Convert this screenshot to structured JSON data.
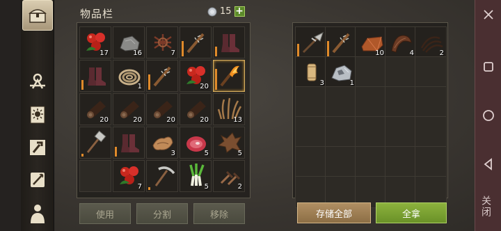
{
  "inventory": {
    "title": "物品栏",
    "currency_count": "15",
    "add_symbol": "+",
    "items": [
      {
        "icon": "berries-icon",
        "qty": "17"
      },
      {
        "icon": "stone-icon",
        "qty": "16"
      },
      {
        "icon": "fiber-bundle-icon",
        "qty": "7"
      },
      {
        "icon": "spiked-club-icon",
        "qty": ""
      },
      {
        "icon": "leather-boots-icon",
        "qty": ""
      },
      {
        "icon": "leather-boots-icon",
        "qty": ""
      },
      {
        "icon": "rope-icon",
        "qty": "1"
      },
      {
        "icon": "spiked-club-icon",
        "qty": ""
      },
      {
        "icon": "berries-icon",
        "qty": "20"
      },
      {
        "icon": "burning-torch-icon",
        "qty": ""
      },
      {
        "icon": "log-icon",
        "qty": "20"
      },
      {
        "icon": "log-icon",
        "qty": "20"
      },
      {
        "icon": "log-icon",
        "qty": "20"
      },
      {
        "icon": "log-icon",
        "qty": "20"
      },
      {
        "icon": "dry-grass-icon",
        "qty": "13"
      },
      {
        "icon": "hammer-icon",
        "qty": ""
      },
      {
        "icon": "leather-boots-icon",
        "qty": ""
      },
      {
        "icon": "leather-scraps-icon",
        "qty": "3"
      },
      {
        "icon": "raw-meat-icon",
        "qty": "5"
      },
      {
        "icon": "animal-hide-icon",
        "qty": "5"
      },
      {
        "icon": "empty",
        "qty": ""
      },
      {
        "icon": "berries-icon",
        "qty": "7"
      },
      {
        "icon": "pickaxe-icon",
        "qty": ""
      },
      {
        "icon": "leek-icon",
        "qty": "5"
      },
      {
        "icon": "bone-pieces-icon",
        "qty": "2"
      }
    ],
    "buttons": {
      "use": "使用",
      "split": "分割",
      "remove": "移除"
    }
  },
  "storage": {
    "items": [
      {
        "icon": "halberd-icon",
        "qty": ""
      },
      {
        "icon": "spiked-club-icon",
        "qty": ""
      },
      {
        "icon": "copper-ingot-icon",
        "qty": "10"
      },
      {
        "icon": "leather-strip-icon",
        "qty": "4"
      },
      {
        "icon": "thread-icon",
        "qty": "2"
      },
      {
        "icon": "wooden-stake-icon",
        "qty": "3"
      },
      {
        "icon": "iron-ore-icon",
        "qty": "1"
      }
    ],
    "buttons": {
      "store_all": "存储全部",
      "take_all": "全拿"
    }
  },
  "navbar": {
    "close_label": "关闭"
  },
  "colors": {
    "accent_gold": "#b08f63",
    "accent_green": "#8cb23d",
    "durability": "#e08a2a"
  }
}
